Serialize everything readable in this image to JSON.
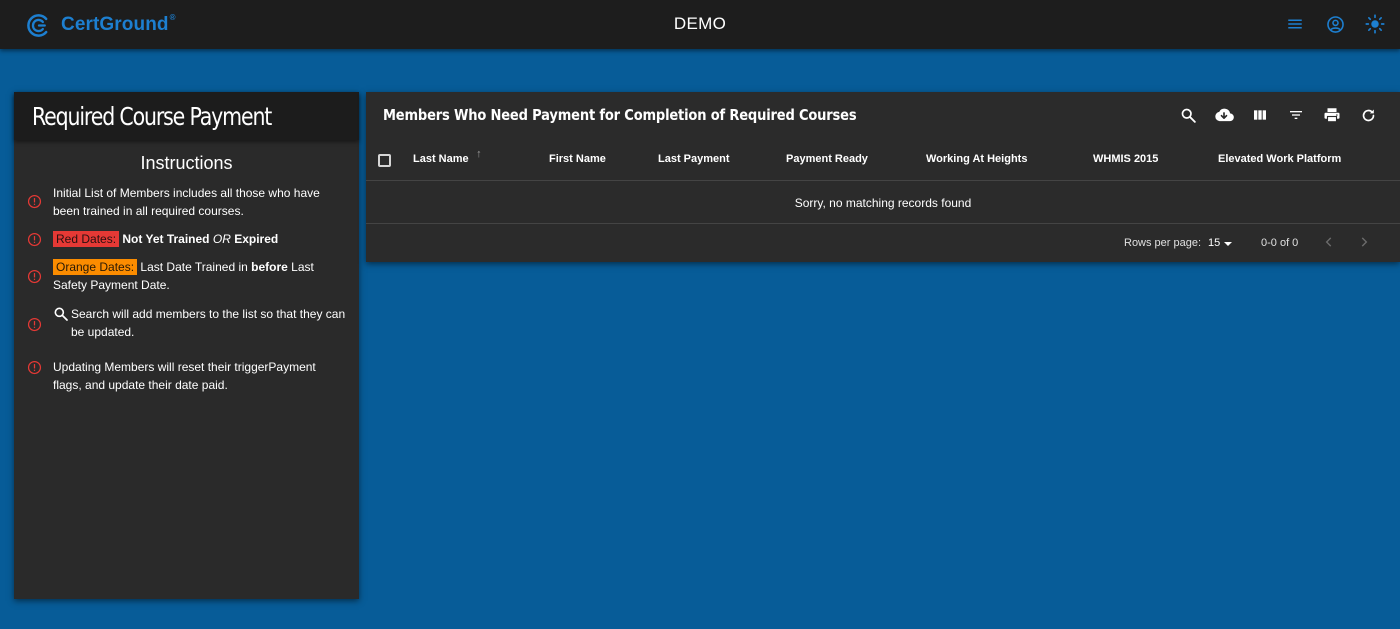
{
  "header": {
    "brand_name": "CertGround",
    "brand_reg": "®",
    "title": "DEMO",
    "icons": [
      "menu-icon",
      "account-circle-icon",
      "brightness-icon"
    ],
    "accent_color": "#1d7fd0"
  },
  "left_panel": {
    "title": "Required Course Payment",
    "instructions_title": "Instructions",
    "items": [
      {
        "text": "Initial List of Members includes all those who have been trained in all required courses."
      },
      {
        "tag": "Red Dates:",
        "bold": "Not Yet Trained",
        "italic": "OR",
        "bold2": "Expired"
      },
      {
        "tag": "Orange Dates:",
        "pre": "Last Date Trained in",
        "bold": "before",
        "post": "Last Safety Payment Date."
      },
      {
        "text": "Search will add members to the list so that they can be updated."
      },
      {
        "text": "Updating Members will reset their triggerPayment flags, and update their date paid."
      }
    ],
    "alert_icon": "alert-circle-icon",
    "red_color": "#e53935",
    "orange_color": "#fb8c00"
  },
  "table": {
    "title": "Members Who Need Payment for Completion of Required Courses",
    "toolbar_icons": [
      "search-icon",
      "cloud-download-icon",
      "view-columns-icon",
      "filter-icon",
      "print-icon",
      "refresh-icon"
    ],
    "columns": [
      "Last Name",
      "First Name",
      "Last Payment",
      "Payment Ready",
      "Working At Heights",
      "WHMIS 2015",
      "Elevated Work Platform"
    ],
    "sort_indicator": "↑",
    "empty_message": "Sorry, no matching records found",
    "footer": {
      "rows_per_page_label": "Rows per page:",
      "rows_per_page_value": "15",
      "range": "0-0 of 0"
    }
  }
}
